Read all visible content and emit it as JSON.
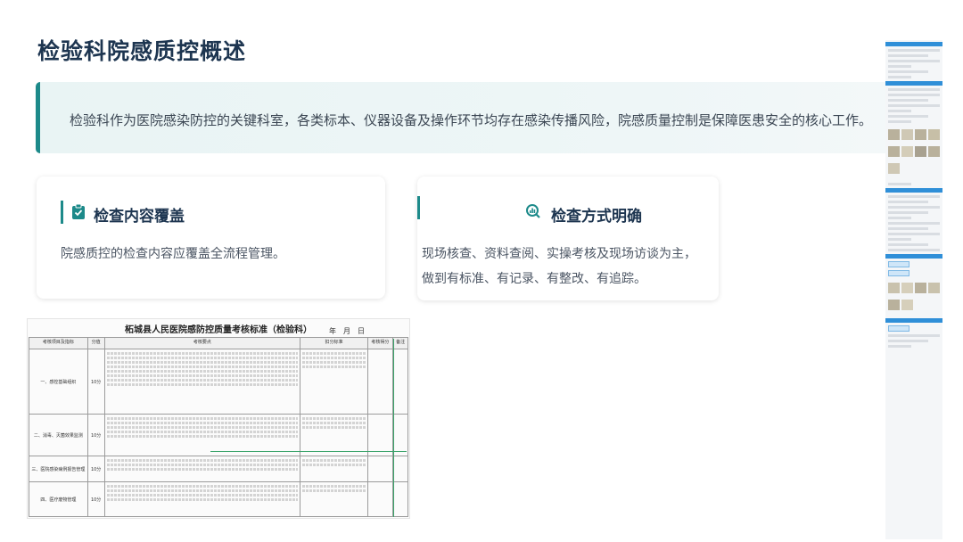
{
  "page": {
    "title": "检验科院感质控概述",
    "accent_color": "#1d8a8a",
    "title_color": "#1d3550"
  },
  "banner": {
    "text": "检验科作为医院感染防控的关键科室，各类标本、仪器设备及操作环节均存在感染传播风险，院感质量控制是保障医患安全的核心工作。"
  },
  "cards": [
    {
      "icon": "clipboard-check-icon",
      "title": "检查内容覆盖",
      "lines": [
        "院感质控的检查内容应覆盖全流程管理。"
      ]
    },
    {
      "icon": "magnifier-chart-icon",
      "title": "检查方式明确",
      "lines": [
        "现场核查、资料查阅、实操考核及现场访谈为主，",
        "做到有标准、有记录、有整改、有追踪。"
      ]
    }
  ],
  "document": {
    "title": "柘城县人民医院感防控质量考核标准（检验科）",
    "date": "年　月　日",
    "headers": [
      "考核项目及指标",
      "分值",
      "考核要点",
      "扣分标准",
      "考核得分",
      "备注"
    ],
    "sections": [
      {
        "name": "一、感控基础组织",
        "score": "10分"
      },
      {
        "name": "二、消毒、灭菌效果监测",
        "score": "10分"
      },
      {
        "name": "三、医院感染病例报告管理",
        "score": "10分"
      },
      {
        "name": "四、医疗废物管理",
        "score": "10分"
      }
    ]
  }
}
